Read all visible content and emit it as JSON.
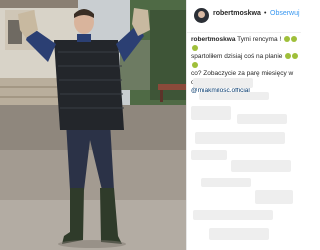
{
  "post": {
    "username": "robertmoskwa",
    "separator": "•",
    "follow_label": "Obserwuj",
    "caption_user": "robertmoskwa",
    "caption_line1": "Tymi rencyma !",
    "caption_line2": "spartoliłem dzisiaj coś na planie",
    "caption_line3": "co? Zobaczycie za parę miesięcy w odc.14",
    "caption_mention": "@mjakmilosc.official"
  },
  "icons": {
    "avatar": "profile-avatar",
    "emoji": "laughing-face-emoji"
  },
  "colors": {
    "follow": "#3897f0",
    "mention": "#003569",
    "emoji": "#9fbf3a"
  }
}
